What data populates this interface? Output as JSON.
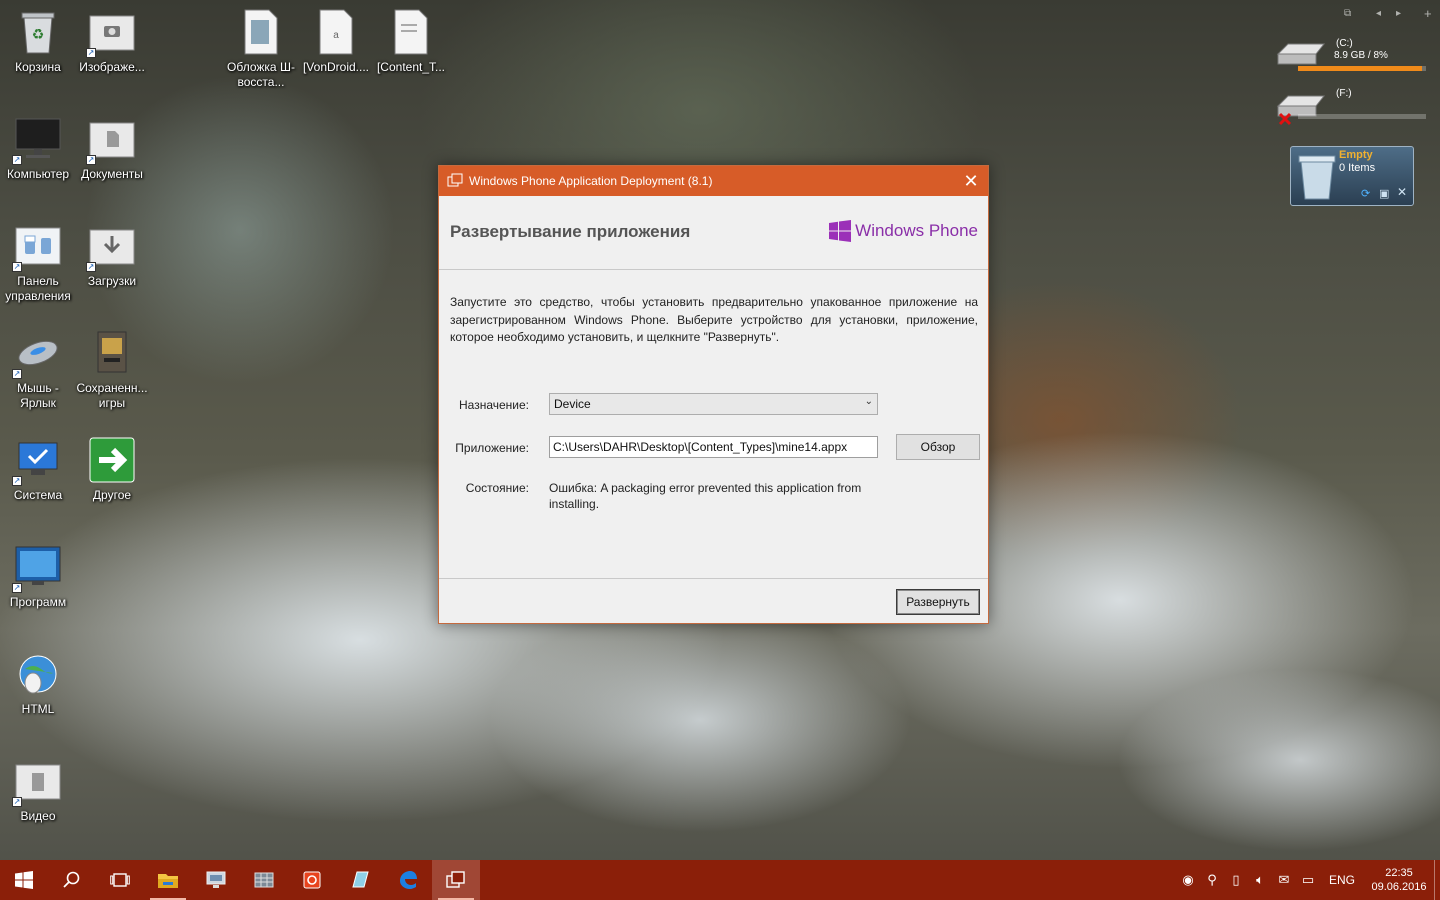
{
  "desktop": {
    "icons": [
      {
        "label": "Корзина",
        "icon": "recycle-bin-icon"
      },
      {
        "label": "Изображе...",
        "icon": "pictures-folder-icon"
      },
      {
        "label": "Обложка Ш-восста...",
        "icon": "document-icon"
      },
      {
        "label": "[VonDroid....",
        "icon": "document-icon"
      },
      {
        "label": "[Content_T...",
        "icon": "document-icon"
      },
      {
        "label": "Компьютер",
        "icon": "computer-icon"
      },
      {
        "label": "Документы",
        "icon": "documents-folder-icon"
      },
      {
        "label": "Панель управления",
        "icon": "control-panel-icon"
      },
      {
        "label": "Загрузки",
        "icon": "downloads-folder-icon"
      },
      {
        "label": "Мышь - Ярлык",
        "icon": "mouse-icon"
      },
      {
        "label": "Сохраненн... игры",
        "icon": "saved-games-icon"
      },
      {
        "label": "Система",
        "icon": "system-icon"
      },
      {
        "label": "Другое",
        "icon": "arrow-right-icon"
      },
      {
        "label": "Программ",
        "icon": "programs-icon"
      },
      {
        "label": "HTML",
        "icon": "globe-icon"
      },
      {
        "label": "Видео",
        "icon": "video-folder-icon"
      }
    ]
  },
  "gadgets": {
    "drive_c": {
      "label": "(C:)",
      "usage": "8.9 GB / 8%",
      "fill_fraction": 0.97
    },
    "drive_f": {
      "label": "(F:)"
    },
    "recycle": {
      "status": "Empty",
      "items": "0 Items"
    }
  },
  "dialog": {
    "title": "Windows Phone Application Deployment (8.1)",
    "heading": "Развертывание приложения",
    "brand": "Windows Phone",
    "description": "Запустите это средство, чтобы установить предварительно упакованное приложение на зарегистрированном Windows Phone. Выберите устройство для установки, приложение, которое необходимо установить, и щелкните \"Развернуть\".",
    "target_label": "Назначение:",
    "target_value": "Device",
    "app_label": "Приложение:",
    "app_value": "C:\\Users\\DAHR\\Desktop\\[Content_Types]\\mine14.appx",
    "browse_label": "Обзор",
    "status_label": "Состояние:",
    "status_value": "Ошибка: A packaging error prevented this application from installing.",
    "deploy_label": "Развернуть"
  },
  "taskbar": {
    "language": "ENG",
    "time": "22:35",
    "date": "09.06.2016",
    "accent": "#8b1f09"
  }
}
